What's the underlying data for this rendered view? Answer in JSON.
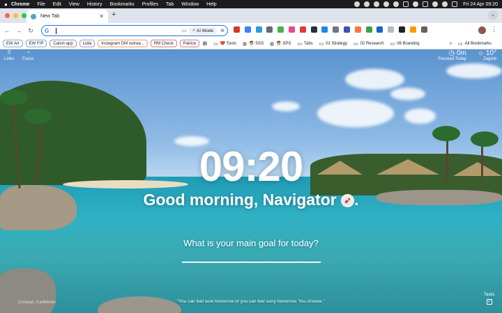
{
  "menubar": {
    "apple": "",
    "items": [
      "Chrome",
      "File",
      "Edit",
      "View",
      "History",
      "Bookmarks",
      "Profiles",
      "Tab",
      "Window",
      "Help"
    ],
    "clock": "Fri 24 Apr  09:20"
  },
  "tab": {
    "title": "New Tab",
    "close": "✕"
  },
  "toolbar": {
    "back": "←",
    "forward": "→",
    "reload": "↻",
    "omnibox_value": "",
    "ai_mode": "AI Mode"
  },
  "bookmarks": {
    "chips": [
      "EW Art",
      "EW F/P",
      "Calvin app",
      "Lidia",
      "Instagram DM outrea...",
      "RM Check",
      "Patrice"
    ],
    "items": [
      {
        "icon": "folder",
        "label": "❤️ Tools"
      },
      {
        "icon": "globe",
        "label": "🧑‍💼 SSS"
      },
      {
        "icon": "globe",
        "label": "🧑‍💼 SPS"
      },
      {
        "icon": "folder",
        "label": "Tabs"
      },
      {
        "icon": "folder",
        "label": "01 Strategy"
      },
      {
        "icon": "folder",
        "label": "02 Research"
      },
      {
        "icon": "folder",
        "label": "06 Branding"
      }
    ],
    "more": "»",
    "all_bookmarks": "All Bookmarks"
  },
  "widgets": {
    "links_label": "Links",
    "focus_label": "Focus",
    "focused_today_value": "0m",
    "focused_today_label": "Focused Today",
    "temperature": "10°",
    "location": "Zagreb"
  },
  "main": {
    "time": "09:20",
    "greeting": "Good morning, Navigator",
    "question": "What is your main goal for today?",
    "goal_value": ""
  },
  "footer": {
    "location_credit": "Curaçao, Caribbean",
    "quote": "“You can feel sore tomorrow or you can feel sorry tomorrow. You choose.”",
    "tasks_label": "Tasks"
  },
  "colors": {
    "omnibox_border": "#1a73e8",
    "tabstrip_bg": "#dfe3eb",
    "menubar_bg": "#1c1c1e"
  }
}
